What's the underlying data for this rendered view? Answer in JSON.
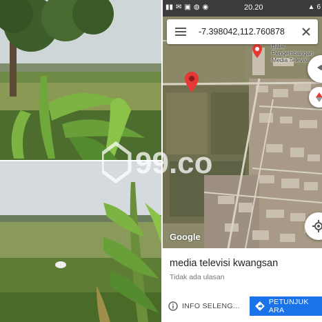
{
  "status": {
    "time": "20.20",
    "battery": "6"
  },
  "search": {
    "coordinates": "-7.398042,112.760878"
  },
  "map": {
    "place_label_line1": "Balai Pengembangan",
    "place_label_line2": "Media Televisi",
    "logo": "Google"
  },
  "place": {
    "title": "media televisi kwangsan",
    "subtitle": "Tidak ada ulasan"
  },
  "actions": {
    "info_label": "INFO SELENG...",
    "directions_label": "PETUNJUK ARA"
  },
  "watermark": {
    "text": "99.co"
  },
  "colors": {
    "accent": "#1a73e8",
    "pin": "#e53935",
    "statusbar": "#3b3b3b"
  }
}
